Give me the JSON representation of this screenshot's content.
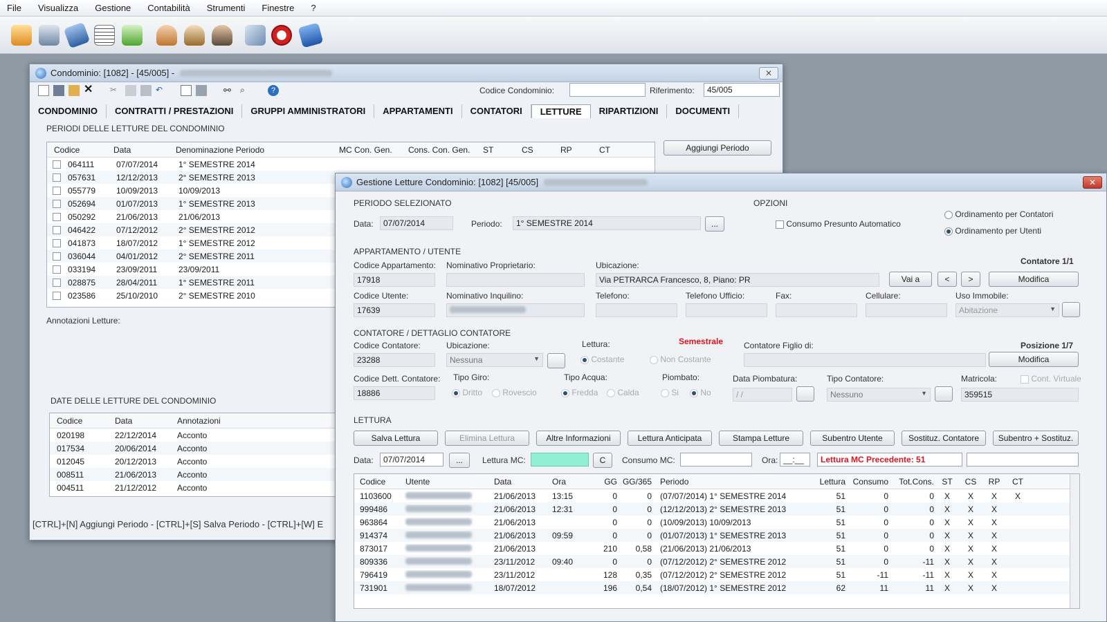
{
  "menu": [
    "File",
    "Visualizza",
    "Gestione",
    "Contabilità",
    "Strumenti",
    "Finestre",
    "?"
  ],
  "toolbar_icons": [
    "home-icon",
    "archive-icon",
    "book-icon",
    "document-list-icon",
    "check-icon",
    "user-icon",
    "users-icon",
    "person-icon",
    "edit-icon",
    "clock-icon",
    "manual-icon"
  ],
  "main": {
    "title": "Condominio: [1082] - [45/005] -",
    "codice_condominio_label": "Codice Condominio:",
    "codice_condominio_value": "",
    "riferimento_label": "Riferimento:",
    "riferimento_value": "45/005",
    "tabs": [
      "CONDOMINIO",
      "CONTRATTI / PRESTAZIONI",
      "GRUPPI AMMINISTRATORI",
      "APPARTAMENTI",
      "CONTATORI",
      "LETTURE",
      "RIPARTIZIONI",
      "DOCUMENTI"
    ],
    "periodi_title": "PERIODI DELLE LETTURE DEL CONDOMINIO",
    "add_period_button": "Aggiungi Periodo",
    "periodi_headers": [
      "Codice",
      "Data",
      "Denominazione Periodo",
      "MC Con. Gen.",
      "Cons. Con. Gen.",
      "ST",
      "CS",
      "RP",
      "CT"
    ],
    "periodi_rows": [
      [
        "064111",
        "07/07/2014",
        "1° SEMESTRE 2014"
      ],
      [
        "057631",
        "12/12/2013",
        "2° SEMESTRE 2013"
      ],
      [
        "055779",
        "10/09/2013",
        "10/09/2013"
      ],
      [
        "052694",
        "01/07/2013",
        "1° SEMESTRE 2013"
      ],
      [
        "050292",
        "21/06/2013",
        "21/06/2013"
      ],
      [
        "046422",
        "07/12/2012",
        "2° SEMESTRE 2012"
      ],
      [
        "041873",
        "18/07/2012",
        "1° SEMESTRE 2012"
      ],
      [
        "036044",
        "04/01/2012",
        "2° SEMESTRE 2011"
      ],
      [
        "033194",
        "23/09/2011",
        "23/09/2011"
      ],
      [
        "028875",
        "28/04/2011",
        "1° SEMESTRE 2011"
      ],
      [
        "023586",
        "25/10/2010",
        "2° SEMESTRE 2010"
      ]
    ],
    "annotazioni_label": "Annotazioni Letture:",
    "date_title": "DATE DELLE LETTURE DEL CONDOMINIO",
    "date_headers": [
      "Codice",
      "Data",
      "Annotazioni"
    ],
    "date_rows": [
      [
        "020198",
        "22/12/2014",
        "Acconto"
      ],
      [
        "017534",
        "20/06/2014",
        "Acconto"
      ],
      [
        "012045",
        "20/12/2013",
        "Acconto"
      ],
      [
        "008511",
        "21/06/2013",
        "Acconto"
      ],
      [
        "004511",
        "21/12/2012",
        "Acconto"
      ]
    ],
    "shortcuts": "[CTRL]+[N] Aggiungi Periodo - [CTRL]+[S] Salva Periodo - [CTRL]+[W] E"
  },
  "dialog": {
    "title": "Gestione Letture Condominio: [1082] [45/005]",
    "periodo_title": "PERIODO SELEZIONATO",
    "data_label": "Data:",
    "data_value": "07/07/2014",
    "periodo_label": "Periodo:",
    "periodo_value": "1° SEMESTRE 2014",
    "ellipsis": "...",
    "opzioni_title": "OPZIONI",
    "consumo_presunto": "Consumo Presunto Automatico",
    "ord_contatori": "Ordinamento per Contatori",
    "ord_utenti": "Ordinamento per Utenti",
    "app_title": "APPARTAMENTO / UTENTE",
    "contatore_count": "Contatore 1/1",
    "cod_app_label": "Codice Appartamento:",
    "cod_app_value": "17918",
    "nom_prop_label": "Nominativo Proprietario:",
    "ubicazione_label": "Ubicazione:",
    "ubicazione_value": "Via PETRARCA Francesco, 8, Piano: PR",
    "vai_a": "Vai a",
    "prev": "<",
    "next": ">",
    "modifica": "Modifica",
    "cod_utente_label": "Codice Utente:",
    "cod_utente_value": "17639",
    "nom_inq_label": "Nominativo Inquilino:",
    "telefono_label": "Telefono:",
    "tel_uff_label": "Telefono Ufficio:",
    "fax_label": "Fax:",
    "cellulare_label": "Cellulare:",
    "uso_label": "Uso Immobile:",
    "uso_value": "Abitazione",
    "contatore_title": "CONTATORE / DETTAGLIO CONTATORE",
    "posizione": "Posizione 1/7",
    "cod_cont_label": "Codice Contatore:",
    "cod_cont_value": "23288",
    "ubic2_label": "Ubicazione:",
    "ubic2_value": "Nessuna",
    "lettura_label": "Lettura:",
    "semestrale": "Semestrale",
    "costante": "Costante",
    "non_costante": "Non Costante",
    "figlio_label": "Contatore Figlio di:",
    "cod_dett_label": "Codice Dett. Contatore:",
    "cod_dett_value": "18886",
    "tipo_giro_label": "Tipo Giro:",
    "diritto": "Dritto",
    "rovescio": "Rovescio",
    "tipo_acqua_label": "Tipo Acqua:",
    "fredda": "Fredda",
    "calda": "Calda",
    "piombato_label": "Piombato:",
    "si": "Si",
    "no": "No",
    "data_piomb_label": "Data Piombatura:",
    "data_piomb_value": "/ /",
    "tipo_cont_label": "Tipo Contatore:",
    "tipo_cont_value": "Nessuno",
    "matricola_label": "Matricola:",
    "cont_virtuale": "Cont. Virtuale",
    "matricola_value": "359515",
    "lettura_title": "LETTURA",
    "buttons": [
      "Salva Lettura",
      "Elimina Lettura",
      "Altre Informazioni",
      "Lettura Anticipata",
      "Stampa Letture",
      "Subentro Utente",
      "Sostituz. Contatore",
      "Subentro + Sostituz."
    ],
    "data2_label": "Data:",
    "data2_value": "07/07/2014",
    "lettura_mc_label": "Lettura MC:",
    "c_button": "C",
    "consumo_mc_label": "Consumo MC:",
    "ora_label": "Ora:",
    "ora_value": "__:__",
    "precedente": "Lettura MC Precedente: 51",
    "table_headers": [
      "Codice",
      "Utente",
      "Data",
      "Ora",
      "GG",
      "GG/365",
      "Periodo",
      "Lettura",
      "Consumo",
      "Tot.Cons.",
      "ST",
      "CS",
      "RP",
      "CT"
    ],
    "rows": [
      [
        "1103600",
        "21/06/2013",
        "13:15",
        "0",
        "0",
        "(07/07/2014) 1° SEMESTRE 2014",
        "51",
        "0",
        "0",
        "X",
        "X",
        "X",
        "X"
      ],
      [
        "999486",
        "21/06/2013",
        "12:31",
        "0",
        "0",
        "(12/12/2013) 2° SEMESTRE 2013",
        "51",
        "0",
        "0",
        "X",
        "X",
        "X",
        ""
      ],
      [
        "963864",
        "21/06/2013",
        "",
        "0",
        "0",
        "(10/09/2013) 10/09/2013",
        "51",
        "0",
        "0",
        "X",
        "X",
        "X",
        ""
      ],
      [
        "914374",
        "21/06/2013",
        "09:59",
        "0",
        "0",
        "(01/07/2013) 1° SEMESTRE 2013",
        "51",
        "0",
        "0",
        "X",
        "X",
        "X",
        ""
      ],
      [
        "873017",
        "21/06/2013",
        "",
        "210",
        "0,58",
        "(21/06/2013) 21/06/2013",
        "51",
        "0",
        "0",
        "X",
        "X",
        "X",
        ""
      ],
      [
        "809336",
        "23/11/2012",
        "09:40",
        "0",
        "0",
        "(07/12/2012) 2° SEMESTRE 2012",
        "51",
        "0",
        "-11",
        "X",
        "X",
        "X",
        ""
      ],
      [
        "796419",
        "23/11/2012",
        "",
        "128",
        "0,35",
        "(07/12/2012) 2° SEMESTRE 2012",
        "51",
        "-11",
        "-11",
        "X",
        "X",
        "X",
        ""
      ],
      [
        "731901",
        "18/07/2012",
        "",
        "196",
        "0,54",
        "(18/07/2012) 1° SEMESTRE 2012",
        "62",
        "11",
        "11",
        "X",
        "X",
        "X",
        ""
      ]
    ]
  },
  "colors": {
    "accent": "#2d6fbf",
    "red_text": "#e0141e",
    "lettura_mc": "#8ff0d4"
  }
}
